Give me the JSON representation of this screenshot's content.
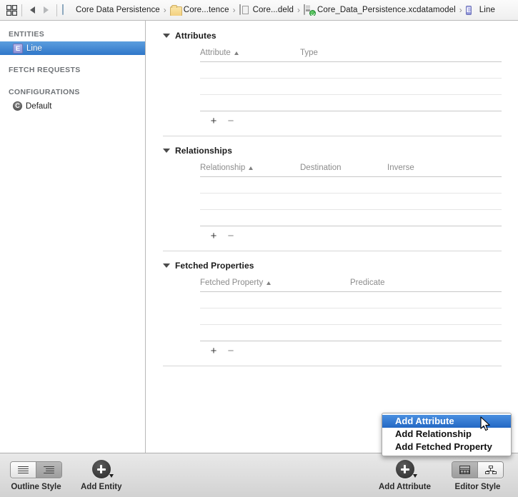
{
  "topbar": {
    "grid_icon": "grid-view-icon",
    "back_label": "Back",
    "forward_label": "Forward",
    "breadcrumbs": [
      {
        "label": "Core Data Persistence",
        "icon": "project-document-icon"
      },
      {
        "label": "Core...tence",
        "icon": "folder-icon"
      },
      {
        "label": "Core...deld",
        "icon": "xcdatamodeld-icon"
      },
      {
        "label": "Core_Data_Persistence.xcdatamodel",
        "icon": "xcdatamodel-icon"
      },
      {
        "label": "Line",
        "icon": "entity-icon"
      }
    ],
    "chevron": "›"
  },
  "sidebar": {
    "sections": [
      {
        "header": "ENTITIES",
        "items": [
          {
            "label": "Line",
            "icon": "entity-icon",
            "icon_text": "E",
            "selected": true
          }
        ]
      },
      {
        "header": "FETCH REQUESTS",
        "items": []
      },
      {
        "header": "CONFIGURATIONS",
        "items": [
          {
            "label": "Default",
            "icon": "configuration-icon",
            "icon_text": "C",
            "selected": false
          }
        ]
      }
    ]
  },
  "editor": {
    "sections": [
      {
        "title": "Attributes",
        "columns": [
          "Attribute",
          "Type"
        ],
        "sorted_column": 0,
        "sort_direction": "ascending",
        "rows": [],
        "empty_row_count": 3,
        "add_button": "+",
        "remove_button": "−"
      },
      {
        "title": "Relationships",
        "columns": [
          "Relationship",
          "Destination",
          "Inverse"
        ],
        "sorted_column": 0,
        "sort_direction": "ascending",
        "rows": [],
        "empty_row_count": 3,
        "add_button": "+",
        "remove_button": "−"
      },
      {
        "title": "Fetched Properties",
        "columns": [
          "Fetched Property",
          "Predicate"
        ],
        "sorted_column": 0,
        "sort_direction": "ascending",
        "rows": [],
        "empty_row_count": 3,
        "add_button": "+",
        "remove_button": "−"
      }
    ]
  },
  "context_menu": {
    "items": [
      {
        "label": "Add Attribute",
        "highlighted": true
      },
      {
        "label": "Add Relationship",
        "highlighted": false
      },
      {
        "label": "Add Fetched Property",
        "highlighted": false
      }
    ]
  },
  "bottom_toolbar": {
    "outline_style": {
      "label": "Outline Style",
      "options": [
        "flat-outline-icon",
        "hierarchical-outline-icon"
      ],
      "selected_index": 1
    },
    "add_entity": {
      "label": "Add Entity",
      "icon": "add-circle-icon"
    },
    "add_attribute": {
      "label": "Add Attribute",
      "icon": "add-circle-icon"
    },
    "editor_style": {
      "label": "Editor Style",
      "options": [
        "table-editor-icon",
        "graph-editor-icon"
      ],
      "selected_index": 0
    }
  },
  "colors": {
    "selection_blue": "#2f77c9",
    "menu_highlight": "#2368c4",
    "entity_icon": "#8d92d8",
    "toolbar_bg": "#d2d2d2"
  }
}
